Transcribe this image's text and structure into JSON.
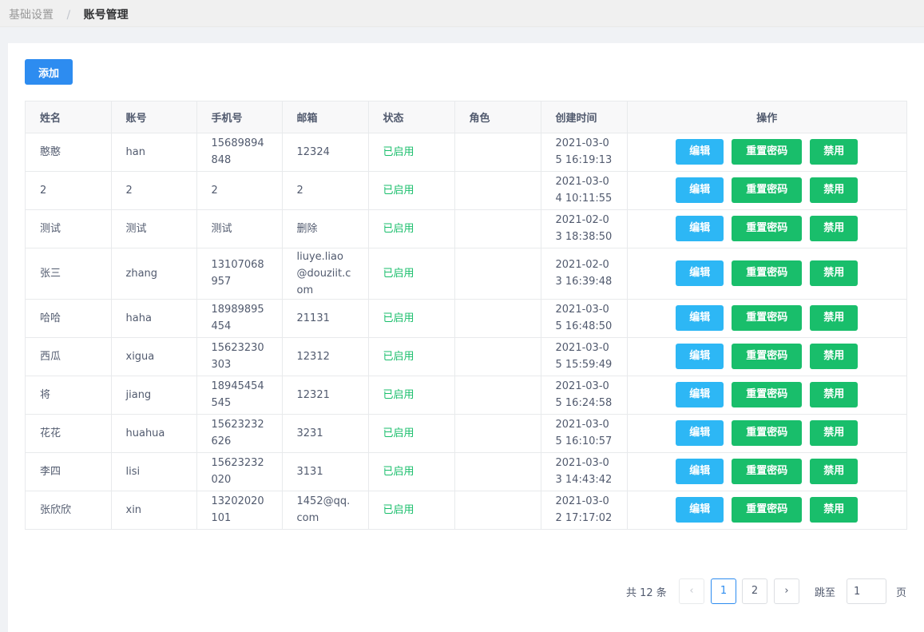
{
  "breadcrumb": {
    "parent": "基础设置",
    "separator": "/",
    "current": "账号管理"
  },
  "toolbar": {
    "add_label": "添加"
  },
  "table": {
    "columns": [
      "姓名",
      "账号",
      "手机号",
      "邮箱",
      "状态",
      "角色",
      "创建时间",
      "操作"
    ],
    "rows": [
      {
        "name": "憨憨",
        "account": "han",
        "phone": "15689894848",
        "email": "12324",
        "status": "已启用",
        "role": "",
        "created": "2021-03-05 16:19:13"
      },
      {
        "name": "2",
        "account": "2",
        "phone": "2",
        "email": "2",
        "status": "已启用",
        "role": "",
        "created": "2021-03-04 10:11:55"
      },
      {
        "name": "测试",
        "account": "测试",
        "phone": "测试",
        "email": "删除",
        "status": "已启用",
        "role": "",
        "created": "2021-02-03 18:38:50"
      },
      {
        "name": "张三",
        "account": "zhang",
        "phone": "13107068957",
        "email": "liuye.liao@douziit.com",
        "status": "已启用",
        "role": "",
        "created": "2021-02-03 16:39:48"
      },
      {
        "name": "哈哈",
        "account": "haha",
        "phone": "18989895454",
        "email": "21131",
        "status": "已启用",
        "role": "",
        "created": "2021-03-05 16:48:50"
      },
      {
        "name": "西瓜",
        "account": "xigua",
        "phone": "15623230303",
        "email": "12312",
        "status": "已启用",
        "role": "",
        "created": "2021-03-05 15:59:49"
      },
      {
        "name": "将",
        "account": "jiang",
        "phone": "18945454545",
        "email": "12321",
        "status": "已启用",
        "role": "",
        "created": "2021-03-05 16:24:58"
      },
      {
        "name": "花花",
        "account": "huahua",
        "phone": "15623232626",
        "email": "3231",
        "status": "已启用",
        "role": "",
        "created": "2021-03-05 16:10:57"
      },
      {
        "name": "李四",
        "account": "lisi",
        "phone": "15623232020",
        "email": "3131",
        "status": "已启用",
        "role": "",
        "created": "2021-03-03 14:43:42"
      },
      {
        "name": "张欣欣",
        "account": "xin",
        "phone": "13202020101",
        "email": "1452@qq.com",
        "status": "已启用",
        "role": "",
        "created": "2021-03-02 17:17:02"
      }
    ],
    "actions": {
      "edit": "编辑",
      "reset_password": "重置密码",
      "disable": "禁用"
    }
  },
  "pagination": {
    "total_text": "共 12 条",
    "prev_icon": "chevron-left-icon",
    "pages": [
      "1",
      "2"
    ],
    "current_page": 1,
    "next_icon": "chevron-right-icon",
    "jump_label": "跳至",
    "jump_value": "1",
    "page_suffix": "页"
  },
  "colors": {
    "primary": "#2d8cf0",
    "info": "#2db7f5",
    "success": "#19be6b"
  }
}
